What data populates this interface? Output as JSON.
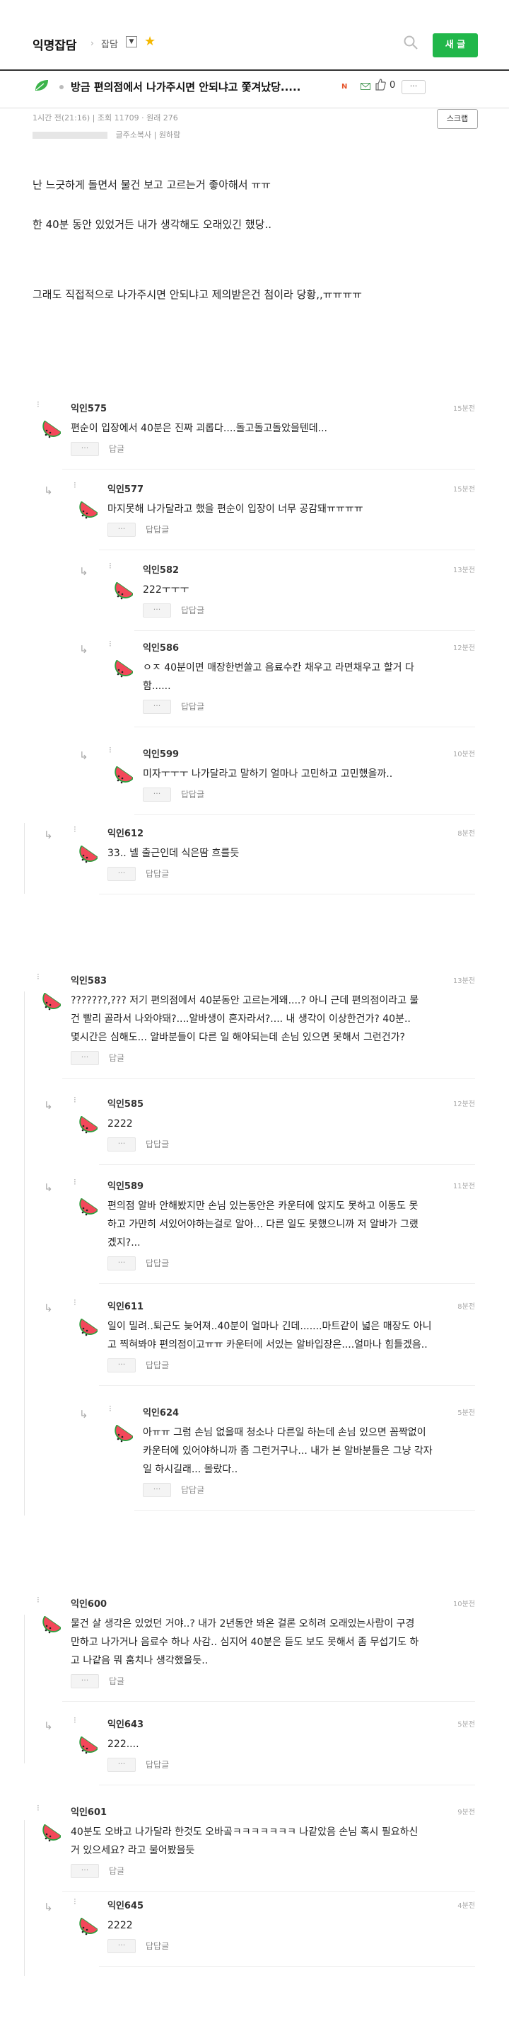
{
  "header": {
    "board_name": "익명잡담",
    "crumb_arrow": "›",
    "category": "잡담",
    "dropdown_glyph": "▼",
    "star_icon": "star-icon",
    "write_label": "새 글"
  },
  "post": {
    "title": "방금 편의점에서 나가주시면 안되냐고 쫓겨났당.....",
    "new_badge": "N",
    "like_count": "0",
    "more_label": "···",
    "meta_time": "1시간 전(21:16)",
    "meta_views": "조회 11709 · 원래 276",
    "meta_copy": "글주소복사",
    "meta_report": "원하람",
    "scrap_label": "스크랩",
    "body": [
      "난 느긋하게 돌면서 물건 보고 고르는거 좋아해서 ㅠㅠ",
      "한 40분 동안 있었거든 내가 생각해도 오래있긴 했당..",
      "그래도 직접적으로 나가주시면 안되냐고 제의받은건 첨이라 당황,,ㅠㅠㅠㅠ"
    ]
  },
  "comments": [
    {
      "nick": "익인575",
      "ago": "15분전",
      "lines": [
        "편순이 입장에서 40분은 진짜 괴롭다....돌고돌고돌았을텐데..."
      ],
      "reply": "답글",
      "dots": "···"
    },
    {
      "nick": "익인577",
      "ago": "15분전",
      "lines": [
        "마지못해 나가달라고 했을 편순이 입장이 너무 공감돼ㅠㅠㅠㅠ"
      ],
      "reply": "답답글",
      "dots": "···"
    },
    {
      "nick": "익인582",
      "ago": "13분전",
      "lines": [
        "222ㅜㅜㅜ"
      ],
      "reply": "답답글",
      "dots": "···"
    },
    {
      "nick": "익인586",
      "ago": "12분전",
      "lines": [
        "ㅇㅈ 40분이면 매장한번쓸고 음료수칸 채우고 라면채우고 할거 다",
        "함......"
      ],
      "reply": "답답글",
      "dots": "···"
    },
    {
      "nick": "익인599",
      "ago": "10분전",
      "lines": [
        "미자ㅜㅜㅜ 나가달라고 말하기 얼마나 고민하고 고민했을까.."
      ],
      "reply": "답답글",
      "dots": "···"
    },
    {
      "nick": "익인612",
      "ago": "8분전",
      "lines": [
        "33.. 넬 출근인데 식은땀 흐를듯"
      ],
      "reply": "답답글",
      "dots": "···"
    },
    {
      "nick": "익인583",
      "ago": "13분전",
      "lines": [
        "???????,??? 저기 편의점에서 40분동안 고르는게왜....? 아니 근데 편의점이라고 물",
        "건 빨리 골라서 나와야돼?....알바생이 혼자라서?.... 내 생각이 이상한건가? 40분..",
        "몇시간은 심해도... 알바분들이 다른 일 해야되는데 손님 있으면 못해서 그런건가?"
      ],
      "reply": "답글",
      "dots": "···"
    },
    {
      "nick": "익인585",
      "ago": "12분전",
      "lines": [
        "2222"
      ],
      "reply": "답답글",
      "dots": "···"
    },
    {
      "nick": "익인589",
      "ago": "11분전",
      "lines": [
        "편의점 알바 안해봤지만 손님 있는동안은 카운터에 앉지도 못하고 이동도 못",
        "하고 가만히 서있어야하는걸로 알아... 다른 일도 못했으니까 저 알바가 그랬",
        "겠지?..."
      ],
      "reply": "답답글",
      "dots": "···"
    },
    {
      "nick": "익인611",
      "ago": "8분전",
      "lines": [
        "일이 밀려..퇴근도 늦어져..40분이 얼마나 긴데.......마트같이 넓은 매장도 아니",
        "고 찍혀봐야 편의점이고ㅠㅠ 카운터에 서있는 알바입장은....얼마나 힘들겠음.."
      ],
      "reply": "답답글",
      "dots": "···"
    },
    {
      "nick": "익인624",
      "ago": "5분전",
      "lines": [
        "아ㅠㅠ 그럼 손님 없을때 청소나 다른일 하는데 손님 있으면 꼼짝없이",
        "카운터에 있어야하니까 좀 그런거구나... 내가 본 알바분들은 그냥 각자",
        "일 하시길래... 몰랐다.."
      ],
      "reply": "답답글",
      "dots": "···"
    },
    {
      "nick": "익인600",
      "ago": "10분전",
      "lines": [
        "물건 살 생각은 있었던 거야..? 내가 2년동안 봐온 걸론 오히려 오래있는사람이 구경",
        "만하고 나가거나 음료수 하나 사감.. 심지어 40분은 듣도 보도 못해서 좀 무섭기도 하",
        "고 나같음 뭐 훔치나 생각했을듯.."
      ],
      "reply": "답글",
      "dots": "···"
    },
    {
      "nick": "익인643",
      "ago": "5분전",
      "lines": [
        "222...."
      ],
      "reply": "답답글",
      "dots": "···"
    },
    {
      "nick": "익인601",
      "ago": "9분전",
      "lines": [
        "40분도 오바고 나가달라 한것도 오바곸ㅋㅋㅋㅋㅋㅋㅋ 나같았음 손님 혹시 필요하신",
        "거 있으세요? 라고 물어봤을듯"
      ],
      "reply": "답글",
      "dots": "···"
    },
    {
      "nick": "익인645",
      "ago": "4분전",
      "lines": [
        "2222"
      ],
      "reply": "답답글",
      "dots": "···"
    }
  ]
}
